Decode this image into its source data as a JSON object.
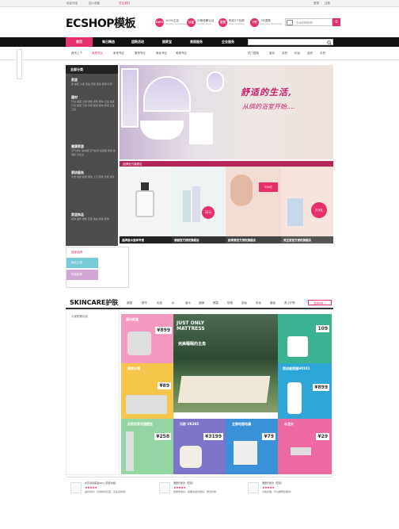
{
  "topbar": {
    "left": [
      "欢迎光临",
      "加入收藏",
      "关注我们"
    ],
    "right": [
      "登录",
      "注册"
    ]
  },
  "logo": "ECSHOP模板",
  "badges": [
    {
      "icon": "100%",
      "text1": "100%正品",
      "text2": "Quality Guarantee"
    },
    {
      "icon": "认证",
      "text1": "ID致信解认证",
      "text2": "Certification"
    },
    {
      "icon": "退货",
      "text1": "购买2个包邮",
      "text2": "Free shipping"
    },
    {
      "icon": "7天",
      "text1": "7天退换",
      "text2": "Delivery Shipping"
    }
  ],
  "search": {
    "placeholder": "去我的购物车",
    "count": "0"
  },
  "nav": {
    "items": [
      "首页",
      "每日精选",
      "团购活动",
      "图家宝",
      "美丽服务",
      "企业服务"
    ],
    "active_index": 0
  },
  "subnav": {
    "left": [
      "首页上个",
      "家居专区",
      "家电专区",
      "服饰专区",
      "美妆专区",
      "美食专区",
      "户外专区"
    ],
    "right": [
      "热门搜索",
      "香奈",
      "耳机",
      "化妆",
      "连衣",
      "手机",
      "充值"
    ]
  },
  "sidebar": {
    "head": "全部分类",
    "cats": [
      {
        "title": "家居",
        "items": "床 被套 沙发 床品 家装 家具 装饰 灯饰"
      },
      {
        "title": "建材",
        "items": "开关 插座 卫浴 地板 瓷砖 厨房 五金 油漆 灯具 壁纸 门窗 吊顶 暖通 家电 家用 五金工具"
      },
      {
        "title": "健康家居",
        "items": "空气净化 净水器 空气检测 加湿器 按摩 除湿机 养生壶"
      },
      {
        "title": "家纺服务",
        "items": "清洗 维修 搬家 保洁 上门 装修 安装 家政"
      },
      {
        "title": "家居饰品",
        "items": "挂钟 摆件 相框 花瓶 烛台 香薰 壁饰"
      }
    ]
  },
  "banner": {
    "title": "舒适的生活,",
    "subtitle": "从缤的浴室开始...."
  },
  "promo": {
    "bar": "品牌官方旗舰店",
    "captions": [
      "品牌香水直邮专营",
      "倩碧官方授权旗舰店",
      "欧莱雅官方授权旗舰店",
      "资生堂官方授权旗舰店"
    ],
    "prices": [
      "32元",
      "328元",
      "万元礼"
    ]
  },
  "brand": {
    "tab": "推荐品牌",
    "rows": [
      "新品上架",
      "热卖推荐"
    ]
  },
  "floor": {
    "title": "SKINCARE护肤",
    "tabs": [
      "面霜",
      "精华",
      "乳液",
      "水",
      "香水",
      "面膜",
      "眼霜",
      "防晒",
      "卸妆",
      "彩妆",
      "套装",
      "男士护肤"
    ],
    "more": "更多护肤 >",
    "left_label": "大家都喜欢买",
    "tiles": [
      {
        "title": "面巾纸盒",
        "price": "¥899"
      },
      {
        "title": "JUST ONLY MATTRESS",
        "sub": "完美睡眠的主角"
      },
      {
        "title": "插座",
        "price": "109"
      },
      {
        "title": "厨房水槽",
        "price": "¥89"
      },
      {
        "title": "恒洁座便器H0101",
        "price": "¥899"
      },
      {
        "title": "吉而世家花园壁挂",
        "price": "¥258"
      },
      {
        "title": "乐欧 UK385",
        "price": "¥3199"
      },
      {
        "title": "全钢电镀地漏",
        "price": "¥79"
      },
      {
        "title": "水龙头",
        "price": "¥29"
      }
    ]
  },
  "reviews": [
    {
      "name": "北京墨镜保温(Kb) (安装书籍)",
      "stars": "★★★★★",
      "text": "是好评好！好用的好东西，还是全新的！"
    },
    {
      "name": "雅居乐新款（套装）",
      "stars": "★★★★★",
      "text": "质量非常好，客服态度也很好，物流也快"
    },
    {
      "name": "雅居乐新款（套装）",
      "stars": "★★★★★",
      "text": "价格合理，可以推荐给朋友！"
    }
  ],
  "colors": {
    "accent": "#e5306b",
    "nav": "#111111",
    "sidebar": "#4d4d4d"
  }
}
